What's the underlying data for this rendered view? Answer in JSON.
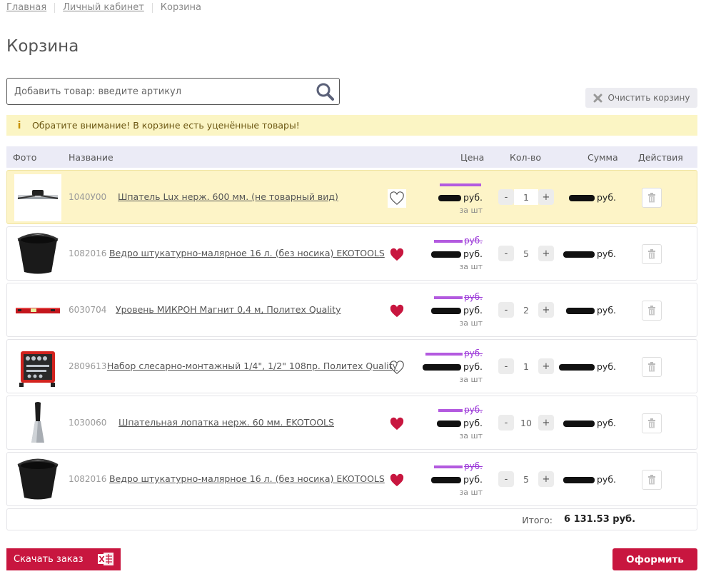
{
  "breadcrumb": [
    "Главная",
    "Личный кабинет",
    "Корзина"
  ],
  "page_title": "Корзина",
  "search": {
    "placeholder": "Добавить товар: введите артикул"
  },
  "clear_cart_label": "Очистить корзину",
  "notice": "Обратите внимание! В корзине есть уценённые товары!",
  "columns": [
    "Фото",
    "Название",
    "Цена",
    "Кол-во",
    "Сумма",
    "Действия"
  ],
  "items": [
    {
      "sku": "1040У00",
      "name": "Шпатель Lux нерж. 600 мм. (не товарный вид)",
      "currency": "руб.",
      "per": "за шт",
      "qty": "1",
      "favorite": false,
      "highlight": true
    },
    {
      "sku": "1082016",
      "name": "Ведро штукатурно-малярное 16 л. (без носика) EKOTOOLS",
      "currency": "руб.",
      "per": "за шт",
      "qty": "5",
      "favorite": true,
      "highlight": false
    },
    {
      "sku": "6030704",
      "name": "Уровень МИКРОН Магнит 0,4 м, Политех Quality",
      "currency": "руб.",
      "per": "за шт",
      "qty": "2",
      "favorite": true,
      "highlight": false
    },
    {
      "sku": "2809613",
      "name": "Набор слесарно-монтажный 1/4\", 1/2\" 108пр. Политех Quality",
      "currency": "руб.",
      "per": "за шт",
      "qty": "1",
      "favorite": false,
      "highlight": false
    },
    {
      "sku": "1030060",
      "name": "Шпательная лопатка нерж. 60 мм. EKOTOOLS",
      "currency": "руб.",
      "per": "за шт",
      "qty": "10",
      "favorite": true,
      "highlight": false
    },
    {
      "sku": "1082016",
      "name": "Ведро штукатурно-малярное 16 л. (без носика) EKOTOOLS",
      "currency": "руб.",
      "per": "за шт",
      "qty": "5",
      "favorite": true,
      "highlight": false
    }
  ],
  "qty_minus": "-",
  "qty_plus": "+",
  "total": {
    "label": "Итого:",
    "value": "6 131.53 руб."
  },
  "download_label": "Скачать заказ",
  "checkout_label": "Оформить",
  "colors": {
    "accent": "#c8163f",
    "notice_bg": "#fbf5c4",
    "row_highlight": "#fdf4c7",
    "old_price": "#9b38d8"
  }
}
